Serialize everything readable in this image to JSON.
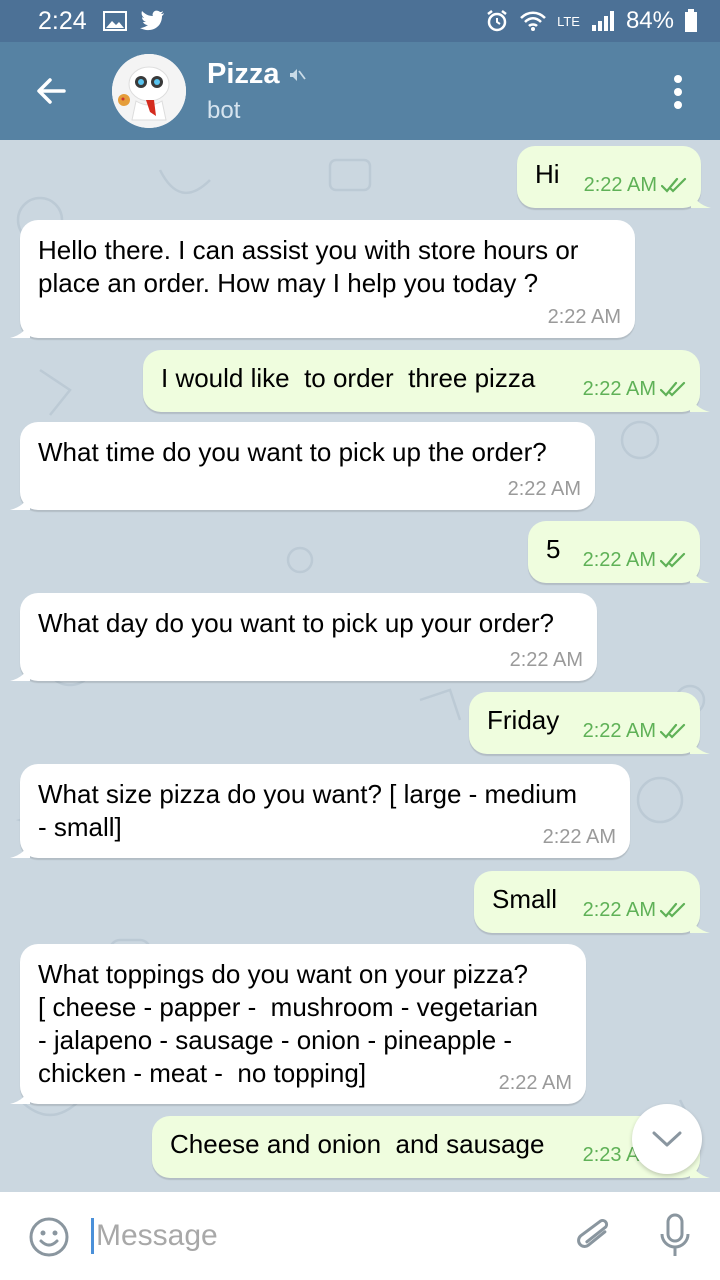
{
  "status": {
    "time": "2:24",
    "battery": "84%",
    "network": "LTE"
  },
  "header": {
    "title": "Pizza",
    "subtitle": "bot"
  },
  "messages": [
    {
      "dir": "out",
      "text": "Hi",
      "time": "2:22 AM"
    },
    {
      "dir": "in",
      "text": "Hello there. I can assist you with store hours or\nplace an order. How may I help you today ?",
      "time": "2:22 AM"
    },
    {
      "dir": "out",
      "text": "I would like  to order  three pizza",
      "time": "2:22 AM"
    },
    {
      "dir": "in",
      "text": "What time do you want to pick up the order?",
      "time": "2:22 AM"
    },
    {
      "dir": "out",
      "text": "5",
      "time": "2:22 AM"
    },
    {
      "dir": "in",
      "text": "What day do you want to pick up your order?",
      "time": "2:22 AM"
    },
    {
      "dir": "out",
      "text": "Friday",
      "time": "2:22 AM"
    },
    {
      "dir": "in",
      "text": "What size pizza do you want? [ large - medium\n- small]",
      "time": "2:22 AM"
    },
    {
      "dir": "out",
      "text": "Small",
      "time": "2:22 AM"
    },
    {
      "dir": "in",
      "text": "What toppings do you want on your pizza?\n[ cheese - papper -  mushroom - vegetarian\n- jalapeno - sausage - onion - pineapple -\nchicken - meat -  no topping]",
      "time": "2:22 AM"
    },
    {
      "dir": "out",
      "text": "Cheese and onion  and sausage",
      "time": "2:23 AM"
    }
  ],
  "composer": {
    "placeholder": "Message"
  },
  "colors": {
    "header": "#5682a3",
    "statusbar": "#4c7196",
    "outgoing": "#effdde",
    "incoming": "#ffffff",
    "chat_bg": "#cbd7e0",
    "check": "#5fb157"
  }
}
